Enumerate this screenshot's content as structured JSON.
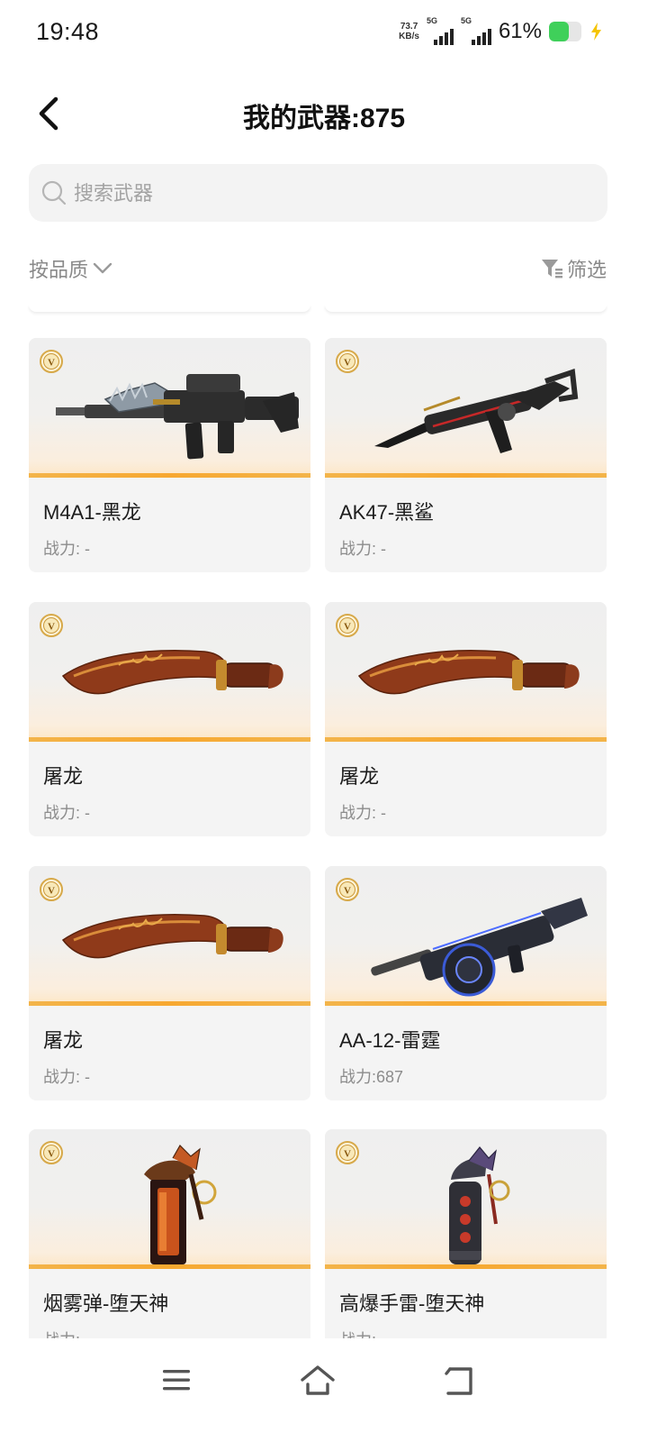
{
  "status_bar": {
    "time": "19:48",
    "net_speed_value": "73.7",
    "net_speed_unit": "KB/s",
    "sim1_label": "5G",
    "sim2_label": "5G",
    "battery_percent": "61%",
    "battery_level": 0.61
  },
  "header": {
    "title": "我的武器:875",
    "back_icon": "chevron-left-icon"
  },
  "search": {
    "placeholder": "搜索武器",
    "value": ""
  },
  "toolbar": {
    "sort_label": "按品质",
    "filter_label": "筛选"
  },
  "weapons": [
    {
      "name": "M4A1-黑龙",
      "power": "战力: -",
      "icon": "rifle-m4a1"
    },
    {
      "name": "AK47-黑鲨",
      "power": "战力: -",
      "icon": "rifle-ak47"
    },
    {
      "name": "屠龙",
      "power": "战力: -",
      "icon": "kukri-knife"
    },
    {
      "name": "屠龙",
      "power": "战力: -",
      "icon": "kukri-knife"
    },
    {
      "name": "屠龙",
      "power": "战力: -",
      "icon": "kukri-knife"
    },
    {
      "name": "AA-12-雷霆",
      "power": "战力:687",
      "icon": "shotgun-aa12"
    },
    {
      "name": "烟雾弹-堕天神",
      "power": "战力: -",
      "icon": "smoke-grenade"
    },
    {
      "name": "高爆手雷-堕天神",
      "power": "战力: -",
      "icon": "he-grenade"
    }
  ],
  "colors": {
    "accent_bar": "#f7a830",
    "card_bg": "#f4f4f4",
    "badge_gold": "#d7a94a"
  },
  "nav_bar": {
    "menu_icon": "menu-icon",
    "home_icon": "home-icon",
    "back_icon": "back-icon"
  }
}
